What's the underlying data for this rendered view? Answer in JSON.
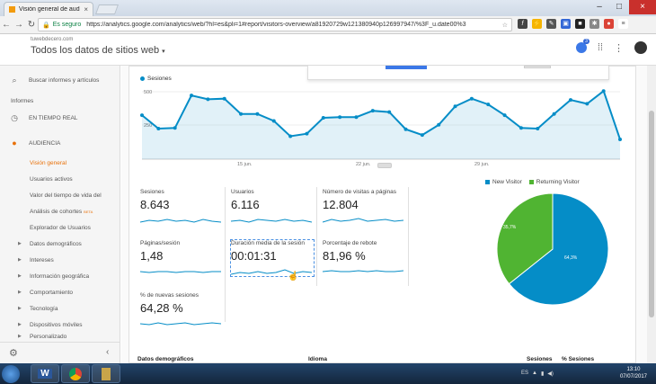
{
  "browser": {
    "tab_title": "Visión general de audien",
    "secure_label": "Es seguro",
    "url": "https://analytics.google.com/analytics/web/?hl=es&pli=1#report/visitors-overview/a81920729w121380940p126997947/%3F_u.date00%3",
    "close_tab": "×",
    "window_min": "–",
    "window_max": "□",
    "window_close": "×"
  },
  "header": {
    "site": "tuwebdecero.com",
    "property": "Todos los datos de sitios web",
    "notif_count": "3"
  },
  "sidebar": {
    "search": "Buscar informes y artículos",
    "section": "Informes",
    "realtime": "EN TIEMPO REAL",
    "audience": "AUDIENCIA",
    "items": [
      {
        "label": "Visión general",
        "active": true
      },
      {
        "label": "Usuarios activos"
      },
      {
        "label": "Valor del tiempo de vida del"
      },
      {
        "label": "Análisis de cohortes",
        "badge": "BETA"
      },
      {
        "label": "Explorador de Usuarios"
      }
    ],
    "groups": [
      "Datos demográficos",
      "Intereses",
      "Información geográfica",
      "Comportamiento",
      "Tecnología",
      "Dispositivos móviles",
      "Personalizado"
    ]
  },
  "chart": {
    "series_label": "Sesiones",
    "y_ticks": [
      "500",
      "250"
    ],
    "x_ticks": [
      "15 jun.",
      "22 jun.",
      "29 jun."
    ]
  },
  "chart_data": {
    "type": "line",
    "ylim": [
      0,
      600
    ],
    "values": [
      345,
      240,
      245,
      500,
      470,
      475,
      355,
      355,
      300,
      180,
      200,
      325,
      330,
      330,
      380,
      370,
      235,
      190,
      270,
      415,
      475,
      430,
      345,
      245,
      240,
      355,
      465,
      435,
      535,
      155
    ]
  },
  "metrics": [
    {
      "label": "Sesiones",
      "value": "8.643"
    },
    {
      "label": "Usuarios",
      "value": "6.116"
    },
    {
      "label": "Número de visitas a páginas",
      "value": "12.804"
    },
    {
      "label": "Páginas/sesión",
      "value": "1,48"
    },
    {
      "label": "Duración media de la sesión",
      "value": "00:01:31"
    },
    {
      "label": "Porcentaje de rebote",
      "value": "81,96 %"
    },
    {
      "label": "% de nuevas sesiones",
      "value": "64,28 %"
    }
  ],
  "pie": {
    "new_label": "New Visitor",
    "returning_label": "Returning Visitor",
    "new_pct": "64,3%",
    "returning_pct": "35,7%",
    "new_value": 64.3,
    "returning_value": 35.7,
    "new_color": "#058dc7",
    "returning_color": "#50b432"
  },
  "bottom": {
    "col1": "Datos demográficos",
    "col2": "Idioma",
    "col3": "Sesiones",
    "col4": "% Sesiones"
  },
  "taskbar": {
    "time": "13:10",
    "date": "07/07/2017"
  }
}
